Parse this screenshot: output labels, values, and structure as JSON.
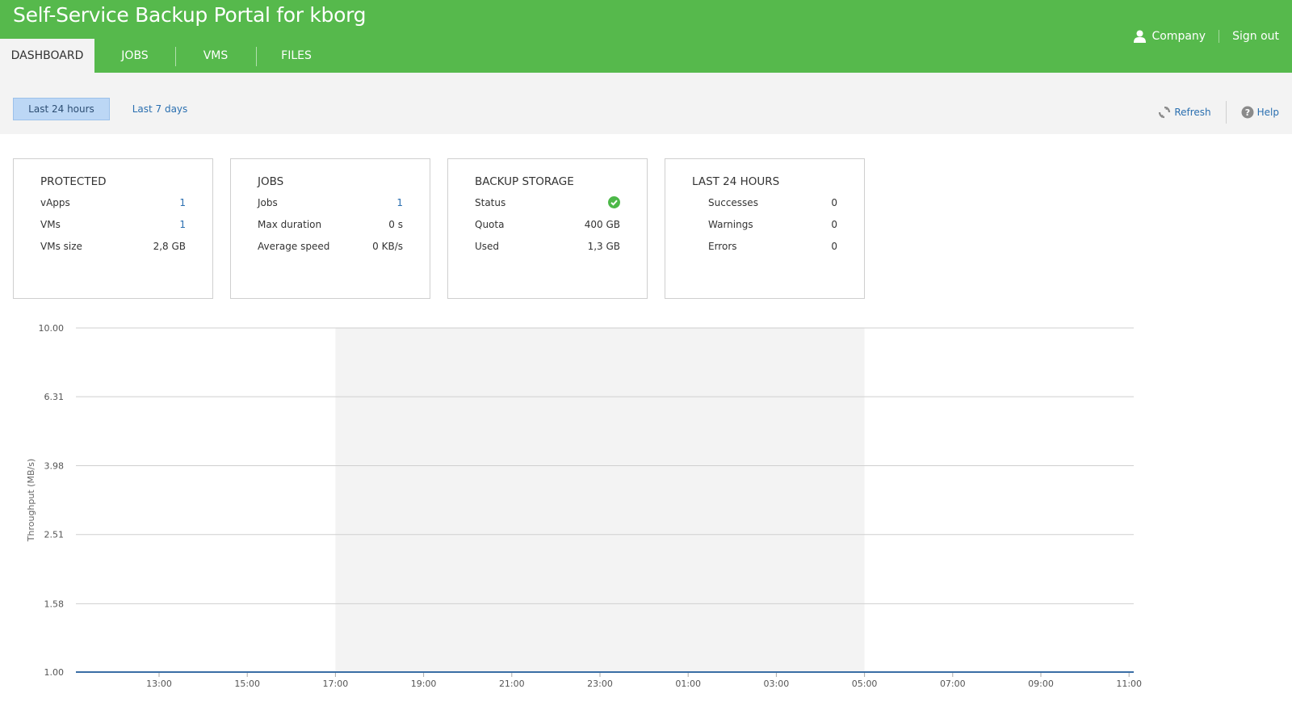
{
  "app": {
    "title": "Self-Service Backup Portal for kborg",
    "user": "Company",
    "signout": "Sign out"
  },
  "tabs": [
    {
      "label": "DASHBOARD",
      "active": true
    },
    {
      "label": "JOBS",
      "active": false
    },
    {
      "label": "VMS",
      "active": false
    },
    {
      "label": "FILES",
      "active": false
    }
  ],
  "toolbar": {
    "range_24h": "Last 24 hours",
    "range_7d": "Last 7 days",
    "selected_range": "Last 24 hours",
    "refresh": "Refresh",
    "help": "Help"
  },
  "cards": {
    "protected": {
      "title": "PROTECTED",
      "rows": [
        {
          "label": "vApps",
          "value": "1"
        },
        {
          "label": "VMs",
          "value": "1"
        },
        {
          "label": "VMs size",
          "value": "2,8 GB"
        }
      ]
    },
    "jobs": {
      "title": "JOBS",
      "rows": [
        {
          "label": "Jobs",
          "value": "1"
        },
        {
          "label": "Max duration",
          "value": "0 s"
        },
        {
          "label": "Average speed",
          "value": "0 KB/s"
        }
      ]
    },
    "storage": {
      "title": "BACKUP STORAGE",
      "rows": [
        {
          "label": "Status",
          "value": "ok"
        },
        {
          "label": "Quota",
          "value": "400 GB"
        },
        {
          "label": "Used",
          "value": "1,3 GB"
        }
      ]
    },
    "last24": {
      "title": "LAST 24 HOURS",
      "rows": [
        {
          "label": "Successes",
          "value": "0"
        },
        {
          "label": "Warnings",
          "value": "0"
        },
        {
          "label": "Errors",
          "value": "0"
        }
      ]
    }
  },
  "colors": {
    "header": "#56b94c",
    "link": "#2a6fb0",
    "status_ok": "#4cb848",
    "series": "#3a6ea5",
    "night_band": "#f3f3f3"
  },
  "chart_data": {
    "type": "line",
    "ylabel": "Throughput (MB/s)",
    "y_ticks": [
      "10.00",
      "6.31",
      "3.98",
      "2.51",
      "1.58",
      "1.00"
    ],
    "ylim": [
      1,
      10
    ],
    "y_scale": "log",
    "x_ticks": [
      "13:00",
      "15:00",
      "17:00",
      "19:00",
      "21:00",
      "23:00",
      "01:00",
      "03:00",
      "05:00",
      "07:00",
      "09:00",
      "11:00"
    ],
    "shaded_range": [
      "17:00",
      "05:00"
    ],
    "grid": true,
    "series": [
      {
        "values": [
          1,
          1,
          1,
          1,
          1,
          1,
          1,
          1,
          1,
          1,
          1,
          1
        ]
      }
    ]
  }
}
